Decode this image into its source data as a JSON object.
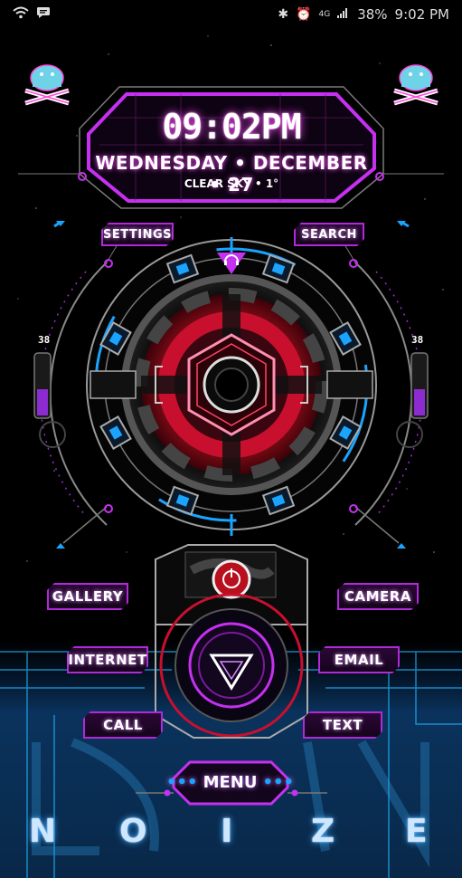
{
  "status_bar": {
    "left_icons": [
      "wifi-icon",
      "chat-icon"
    ],
    "right_icons": [
      "bluetooth-icon",
      "alarm-icon",
      "4g-icon",
      "signal-icon"
    ],
    "battery": "38%",
    "time": "9:02 PM"
  },
  "clock": {
    "time": "09:02PM",
    "date": "WEDNESDAY • DECEMBER • 27",
    "weather": "CLEAR SKY • 1°"
  },
  "gauges": {
    "left": "38",
    "right": "38"
  },
  "shortcuts": {
    "settings": "SETTINGS",
    "search": "SEARCH",
    "gallery": "GALLERY",
    "camera": "CAMERA",
    "internet": "INTERNET",
    "email": "EMAIL",
    "call": "CALL",
    "text": "TEXT",
    "menu": "MENU"
  },
  "brand": {
    "letters": [
      "N",
      "O",
      "I",
      "Z",
      "E"
    ]
  },
  "colors": {
    "accent_purple": "#b02ad8",
    "accent_blue": "#1aa3ff",
    "accent_red": "#c8102e"
  }
}
